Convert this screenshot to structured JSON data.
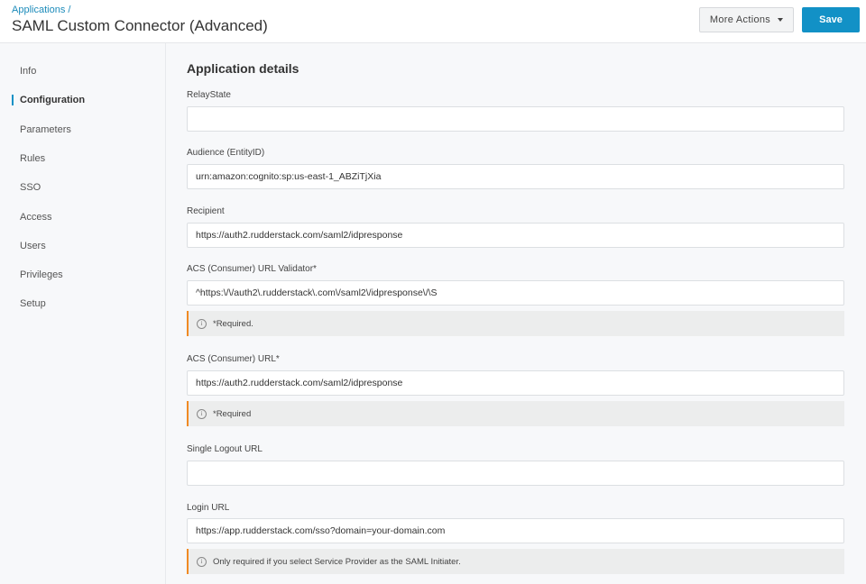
{
  "header": {
    "breadcrumb": "Applications",
    "breadcrumb_sep": "/",
    "title": "SAML Custom Connector (Advanced)",
    "more_actions_label": "More Actions",
    "save_label": "Save"
  },
  "sidebar": {
    "items": [
      {
        "label": "Info",
        "active": false
      },
      {
        "label": "Configuration",
        "active": true
      },
      {
        "label": "Parameters",
        "active": false
      },
      {
        "label": "Rules",
        "active": false
      },
      {
        "label": "SSO",
        "active": false
      },
      {
        "label": "Access",
        "active": false
      },
      {
        "label": "Users",
        "active": false
      },
      {
        "label": "Privileges",
        "active": false
      },
      {
        "label": "Setup",
        "active": false
      }
    ]
  },
  "main": {
    "section_title": "Application details",
    "fields": [
      {
        "label": "RelayState",
        "value": "",
        "note": null
      },
      {
        "label": "Audience (EntityID)",
        "value": "urn:amazon:cognito:sp:us-east-1_ABZiTjXia",
        "note": null
      },
      {
        "label": "Recipient",
        "value": "https://auth2.rudderstack.com/saml2/idpresponse",
        "note": null
      },
      {
        "label": "ACS (Consumer) URL Validator*",
        "value": "^https:\\/\\/auth2\\.rudderstack\\.com\\/saml2\\/idpresponse\\/\\S",
        "note": "*Required."
      },
      {
        "label": "ACS (Consumer) URL*",
        "value": "https://auth2.rudderstack.com/saml2/idpresponse",
        "note": "*Required"
      },
      {
        "label": "Single Logout URL",
        "value": "",
        "note": null
      },
      {
        "label": "Login URL",
        "value": "https://app.rudderstack.com/sso?domain=your-domain.com",
        "note": "Only required if you select Service Provider as the SAML Initiater."
      }
    ],
    "info_icon_glyph": "i"
  },
  "colors": {
    "accent": "#1291c6",
    "note_border": "#f08a24"
  }
}
